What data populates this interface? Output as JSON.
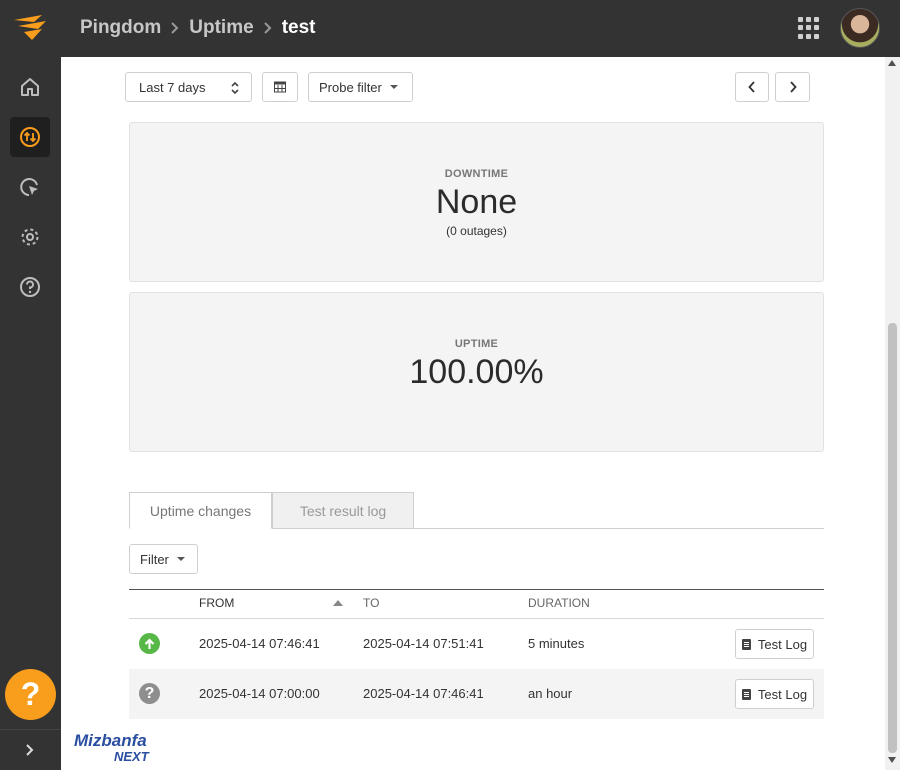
{
  "breadcrumb": {
    "items": [
      "Pingdom",
      "Uptime",
      "test"
    ]
  },
  "toolbar": {
    "range_label": "Last 7 days",
    "probe_filter_label": "Probe filter"
  },
  "stats": {
    "downtime": {
      "label": "DOWNTIME",
      "value": "None",
      "sub": "(0 outages)"
    },
    "uptime": {
      "label": "UPTIME",
      "value": "100.00%"
    }
  },
  "tabs": [
    {
      "label": "Uptime changes",
      "active": true
    },
    {
      "label": "Test result log",
      "active": false
    }
  ],
  "filter": {
    "label": "Filter"
  },
  "table": {
    "columns": [
      "FROM",
      "TO",
      "DURATION"
    ],
    "sort": {
      "column": "FROM",
      "direction": "ascending"
    },
    "rows": [
      {
        "status": "up",
        "from": "2025-04-14 07:46:41",
        "to": "2025-04-14 07:51:41",
        "duration": "5 minutes",
        "action": "Test Log"
      },
      {
        "status": "unknown",
        "from": "2025-04-14 07:00:00",
        "to": "2025-04-14 07:46:41",
        "duration": "an hour",
        "action": "Test Log"
      }
    ]
  },
  "help": {
    "label": "?"
  },
  "watermark": {
    "line1": "Mizbanfa",
    "line2": "NEXT"
  },
  "colors": {
    "accent": "#f99d1c",
    "up": "#57b847",
    "unknown": "#8e8e8e",
    "sidebar": "#333333"
  },
  "icons": {
    "sidebar": [
      "home-icon",
      "uptime-icon",
      "page-speed-icon",
      "settings-icon",
      "help-circle-icon"
    ]
  }
}
